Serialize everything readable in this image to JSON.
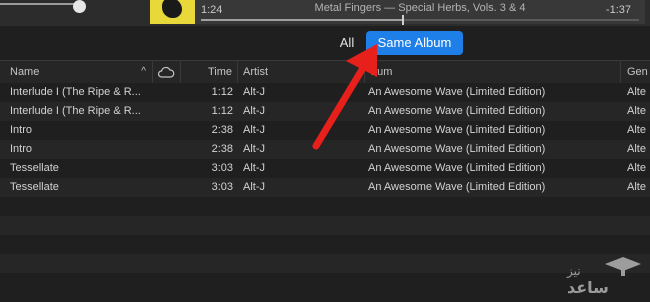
{
  "player": {
    "elapsed": "1:24",
    "now_playing": "Metal Fingers — Special Herbs, Vols. 3 & 4",
    "remaining": "-1:37",
    "progress": 0.46
  },
  "filter": {
    "all_label": "All",
    "same_album_label": "Same Album",
    "accent_color": "#1f7fe8"
  },
  "table": {
    "columns": {
      "name": "Name",
      "cloud_icon": "cloud-icon",
      "time": "Time",
      "artist": "Artist",
      "album": "bum",
      "genre": "Gen"
    },
    "rows": [
      {
        "name": "Interlude I (The Ripe & R...",
        "time": "1:12",
        "artist": "Alt-J",
        "album": "An Awesome Wave (Limited Edition)",
        "genre": "Alte"
      },
      {
        "name": "Interlude I (The Ripe & R...",
        "time": "1:12",
        "artist": "Alt-J",
        "album": "An Awesome Wave (Limited Edition)",
        "genre": "Alte"
      },
      {
        "name": "Intro",
        "time": "2:38",
        "artist": "Alt-J",
        "album": "An Awesome Wave (Limited Edition)",
        "genre": "Alte"
      },
      {
        "name": "Intro",
        "time": "2:38",
        "artist": "Alt-J",
        "album": "An Awesome Wave (Limited Edition)",
        "genre": "Alte"
      },
      {
        "name": "Tessellate",
        "time": "3:03",
        "artist": "Alt-J",
        "album": "An Awesome Wave (Limited Edition)",
        "genre": "Alte"
      },
      {
        "name": "Tessellate",
        "time": "3:03",
        "artist": "Alt-J",
        "album": "An Awesome Wave (Limited Edition)",
        "genre": "Alte"
      }
    ]
  },
  "annotation": {
    "arrow_color": "#e8201c"
  },
  "watermark": {
    "text": "نیز ساعد"
  }
}
